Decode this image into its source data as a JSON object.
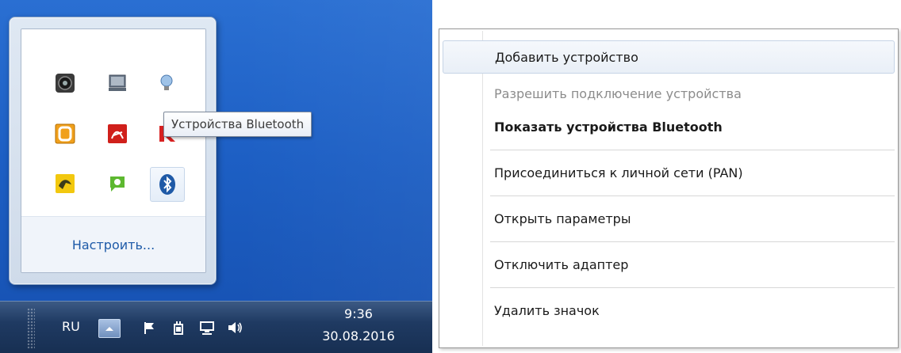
{
  "flyout": {
    "customize_label": "Настроить...",
    "tooltip": "Устройства Bluetooth",
    "icons": [
      "media-player-icon",
      "laptop-display-icon",
      "light-bulb-icon",
      "orange-o-app-icon",
      "acrobat-reader-icon",
      "red-k-app-icon",
      "yellow-app-icon",
      "green-chat-icon",
      "bluetooth-icon"
    ]
  },
  "taskbar": {
    "language": "RU",
    "time": "9:36",
    "date": "30.08.2016",
    "icons": [
      "show-hidden-icons-icon",
      "action-center-flag-icon",
      "power-icon",
      "network-icon",
      "volume-icon"
    ]
  },
  "context_menu": {
    "items": [
      {
        "label": "Добавить устройство",
        "state": "highlighted"
      },
      {
        "label": "Разрешить подключение устройства",
        "state": "disabled"
      },
      {
        "label": "Показать устройства Bluetooth",
        "state": "default-bold"
      },
      {
        "label": "Присоединиться к личной сети (PAN)",
        "state": "normal"
      },
      {
        "label": "Открыть параметры",
        "state": "normal"
      },
      {
        "label": "Отключить адаптер",
        "state": "normal"
      },
      {
        "label": "Удалить значок",
        "state": "normal"
      }
    ]
  },
  "colors": {
    "desktop": "#1d5fc4",
    "taskbar": "#1f3a62",
    "link": "#1e5aa8",
    "disabled_text": "#8c8c8c"
  }
}
